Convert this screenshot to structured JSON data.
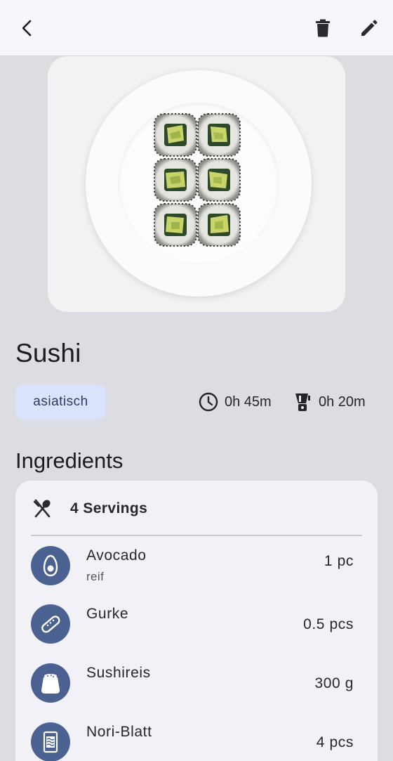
{
  "toolbar": {
    "back_icon": "arrow-back-icon",
    "delete_icon": "trash-icon",
    "edit_icon": "pencil-icon"
  },
  "recipe": {
    "photo_description_icon": "sushi-plate-image",
    "title": "Sushi",
    "tag": "asiatisch",
    "total_time": "0h 45m",
    "prep_time": "0h 20m"
  },
  "ingredients": {
    "heading": "Ingredients",
    "servings": "4 Servings",
    "items": [
      {
        "name": "Avocado",
        "note": "reif",
        "qty": "1 pc",
        "icon": "avocado-icon"
      },
      {
        "name": "Gurke",
        "note": "",
        "qty": "0.5 pcs",
        "icon": "cucumber-icon"
      },
      {
        "name": "Sushireis",
        "note": "",
        "qty": "300 g",
        "icon": "rice-bag-icon"
      },
      {
        "name": "Nori-Blatt",
        "note": "",
        "qty": "4 pcs",
        "icon": "nori-pack-icon"
      }
    ]
  },
  "colors": {
    "background": "#dcdde2",
    "topbar": "#f6f6fb",
    "tag_bg": "#dbe3fb",
    "icon_circle": "#4a6192",
    "card": "#f1f1f7"
  }
}
